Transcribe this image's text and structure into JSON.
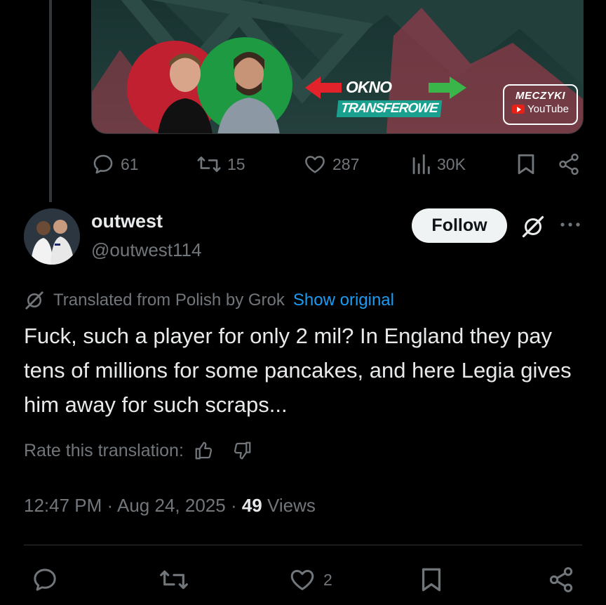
{
  "media": {
    "banner_title": "OKNO",
    "banner_subtitle": "TRANSFEROWE",
    "brand_name": "MECZYKI",
    "brand_platform": "YouTube"
  },
  "top_actions": {
    "replies": "61",
    "reposts": "15",
    "likes": "287",
    "views": "30K"
  },
  "author": {
    "display_name": "outwest",
    "handle": "@outwest114",
    "follow_label": "Follow"
  },
  "translation": {
    "notice": "Translated from Polish by Grok",
    "show_original": "Show original",
    "rate_label": "Rate this translation:"
  },
  "tweet": {
    "text": "Fuck, such a player for only 2 mil? In England they pay tens of millions for some pancakes, and here Legia gives him away for such scraps...",
    "time": "12:47 PM",
    "separator": "·",
    "date": "Aug 24, 2025",
    "views_count": "49",
    "views_label": "Views"
  },
  "bottom_actions": {
    "likes": "2"
  },
  "colors": {
    "background": "#000000",
    "text_primary": "#e7e9ea",
    "text_secondary": "#71767b",
    "link": "#1d9bf0",
    "divider": "#2f3336"
  }
}
